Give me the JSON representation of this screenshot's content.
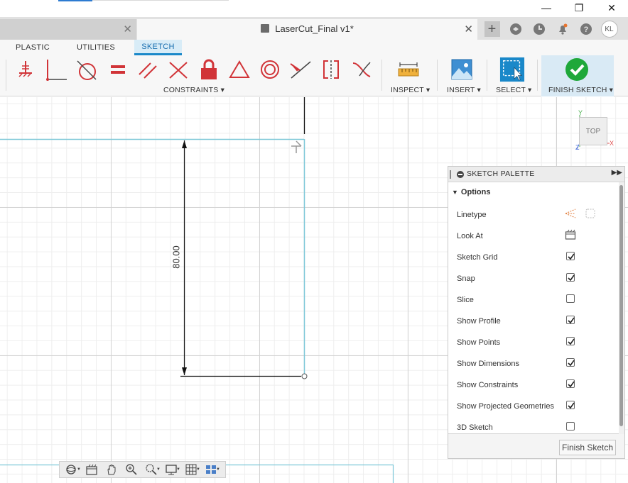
{
  "window": {
    "minimize": "—",
    "maximize": "❐",
    "close": "✕"
  },
  "tabs": {
    "inactive_close": "✕",
    "document_title": "LaserCut_Final v1*",
    "active_close": "✕",
    "user_initials": "KL"
  },
  "ribbon": {
    "tabs": [
      "PLASTIC",
      "UTILITIES",
      "SKETCH"
    ],
    "active_tab": "SKETCH",
    "groups": {
      "constraints": "CONSTRAINTS ▾",
      "inspect": "INSPECT ▾",
      "insert": "INSERT ▾",
      "select": "SELECT ▾",
      "finish": "FINISH SKETCH ▾"
    }
  },
  "canvas": {
    "dimension_value": "80.00",
    "view_cube_label": "TOP",
    "axis_y": "Y",
    "axis_x": "X",
    "axis_z": "Z"
  },
  "palette": {
    "title": "SKETCH PALETTE",
    "section": "Options",
    "expand": "▶▶",
    "rows": [
      {
        "label": "Linetype",
        "kind": "icons"
      },
      {
        "label": "Look At",
        "kind": "icon"
      },
      {
        "label": "Sketch Grid",
        "kind": "check",
        "checked": true
      },
      {
        "label": "Snap",
        "kind": "check",
        "checked": true
      },
      {
        "label": "Slice",
        "kind": "check",
        "checked": false
      },
      {
        "label": "Show Profile",
        "kind": "check",
        "checked": true
      },
      {
        "label": "Show Points",
        "kind": "check",
        "checked": true
      },
      {
        "label": "Show Dimensions",
        "kind": "check",
        "checked": true
      },
      {
        "label": "Show Constraints",
        "kind": "check",
        "checked": true
      },
      {
        "label": "Show Projected Geometries",
        "kind": "check",
        "checked": true
      },
      {
        "label": "3D Sketch",
        "kind": "check",
        "checked": false
      }
    ],
    "finish_button": "Finish Sketch"
  },
  "colors": {
    "accent_blue": "#1a88c9",
    "constraint_red": "#d13438",
    "finish_green": "#1fa83a",
    "sketch_line": "#7ec8d8"
  }
}
